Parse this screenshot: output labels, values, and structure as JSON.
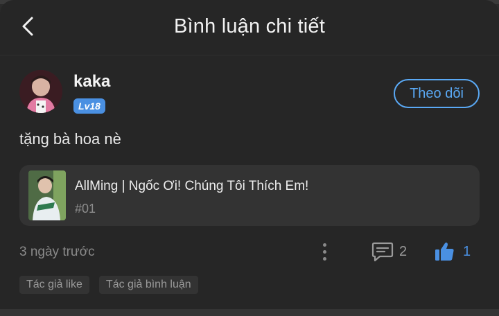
{
  "header": {
    "title": "Bình luận chi tiết",
    "back_icon": "chevron-left-icon"
  },
  "user": {
    "name": "kaka",
    "level": "Lv18",
    "follow_label": "Theo dõi"
  },
  "comment": {
    "text": "tặng bà hoa nè"
  },
  "work_card": {
    "title": "AllMing | Ngốc Ơi! Chúng Tôi Thích Em!",
    "episode": "#01"
  },
  "meta": {
    "time": "3 ngày trước",
    "reply_count": "2",
    "like_count": "1"
  },
  "tags": [
    "Tác giả like",
    "Tác giả bình luận"
  ],
  "colors": {
    "accent": "#4a90e2",
    "follow": "#5aa9f5",
    "background": "#262626",
    "card": "#333333"
  }
}
